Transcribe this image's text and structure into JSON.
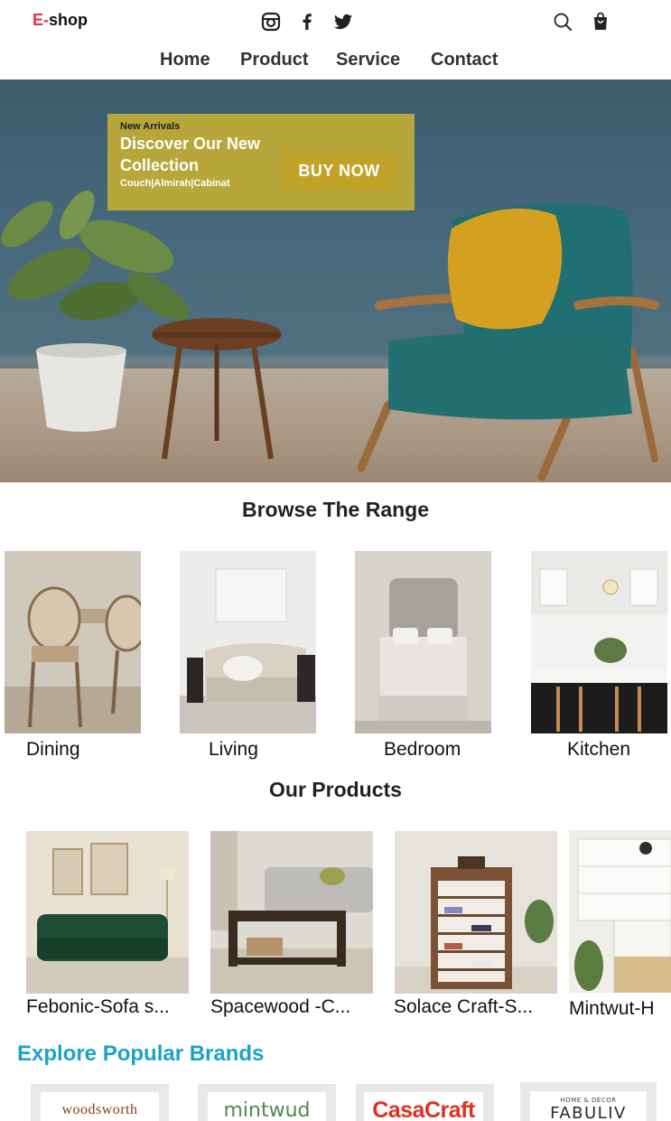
{
  "header": {
    "logo_e": "E-",
    "logo_rest": "shop",
    "social_icons": [
      "instagram-icon",
      "facebook-icon",
      "twitter-icon"
    ],
    "action_icons": [
      "search-icon",
      "shopping-bag-icon"
    ]
  },
  "nav": {
    "items": [
      {
        "label": "Home"
      },
      {
        "label": "Product"
      },
      {
        "label": "Service"
      },
      {
        "label": "Contact"
      }
    ]
  },
  "hero": {
    "eyebrow": "New Arrivals",
    "headline": "Discover Our New Collection",
    "categories": "Couch|Almirah|Cabinat",
    "cta_label": "BUY NOW",
    "colors": {
      "wall": "#47697b",
      "banner": "#b7a73a",
      "button": "#c2a32a",
      "chair": "#1f6f73",
      "pillow": "#d4a020",
      "wood": "#8a5a34"
    }
  },
  "range": {
    "title": "Browse The Range",
    "items": [
      {
        "label": "Dining"
      },
      {
        "label": "Living"
      },
      {
        "label": "Bedroom"
      },
      {
        "label": "Kitchen"
      }
    ]
  },
  "products": {
    "title": "Our Products",
    "items": [
      {
        "name": "Febonic-Sofa s..."
      },
      {
        "name": "Spacewood -C..."
      },
      {
        "name": "Solace Craft-S..."
      },
      {
        "name": "Mintwut-H"
      }
    ]
  },
  "brands": {
    "title": "Explore Popular Brands",
    "items": [
      {
        "name": "woodsworth",
        "color": "#8a3a12"
      },
      {
        "name": "mintwud",
        "color": "#4f8a4a"
      },
      {
        "name": "CasaCraft",
        "color": "#e0301e"
      },
      {
        "name": "FABULIV",
        "tagline": "HOME & DECOR",
        "color": "#2a2a2a"
      }
    ]
  }
}
